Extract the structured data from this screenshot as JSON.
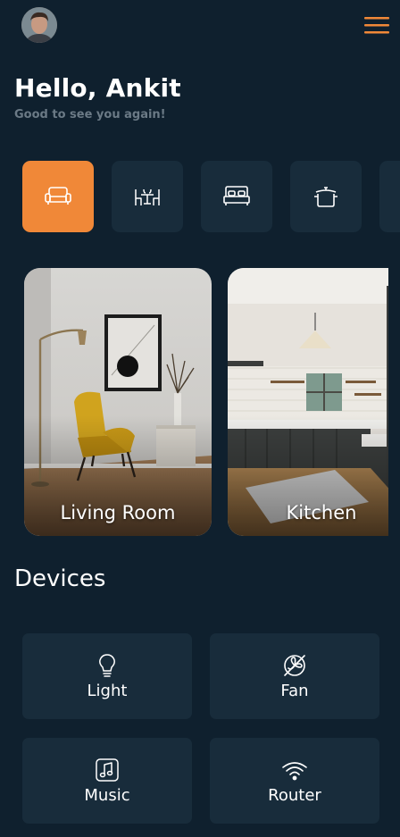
{
  "header": {
    "avatar_alt": "user-avatar",
    "menu_icon": "hamburger-menu-icon",
    "accent_color": "#f08838"
  },
  "greeting": {
    "title": "Hello, Ankit",
    "subtitle": "Good to see you again!"
  },
  "categories": [
    {
      "icon": "sofa-icon",
      "selected": true
    },
    {
      "icon": "dining-icon",
      "selected": false
    },
    {
      "icon": "bed-icon",
      "selected": false
    },
    {
      "icon": "cooking-pot-icon",
      "selected": false
    }
  ],
  "rooms": [
    {
      "label": "Living Room"
    },
    {
      "label": "Kitchen"
    }
  ],
  "devices": {
    "title": "Devices",
    "items": [
      {
        "label": "Light",
        "icon": "lightbulb-icon"
      },
      {
        "label": "Fan",
        "icon": "fan-off-icon"
      },
      {
        "label": "Music",
        "icon": "music-icon"
      },
      {
        "label": "Router",
        "icon": "wifi-icon"
      }
    ]
  }
}
